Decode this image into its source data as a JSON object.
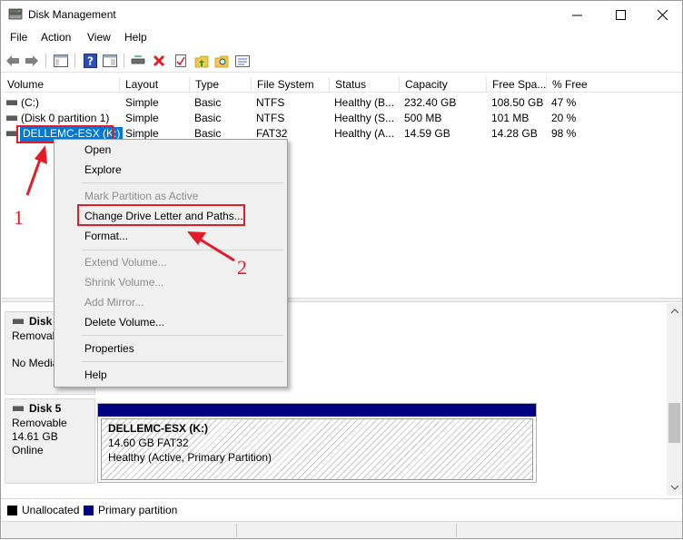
{
  "window": {
    "title": "Disk Management",
    "controls": {
      "minimize": "—",
      "maximize": "☐",
      "close": "✕"
    }
  },
  "menu": [
    "File",
    "Action",
    "View",
    "Help"
  ],
  "toolbar": {
    "icons": [
      "back-arrow-icon",
      "forward-arrow-icon",
      "console-tree-icon",
      "help-icon",
      "show-pane-icon",
      "connect-drive-icon",
      "delete-icon",
      "checklist-icon",
      "up-folder-icon",
      "search-folder-icon",
      "properties-icon"
    ]
  },
  "volume_table": {
    "columns": [
      "Volume",
      "Layout",
      "Type",
      "File System",
      "Status",
      "Capacity",
      "Free Spa...",
      "% Free"
    ],
    "rows": [
      [
        "(C:)",
        "Simple",
        "Basic",
        "NTFS",
        "Healthy (B...",
        "232.40 GB",
        "108.50 GB",
        "47 %"
      ],
      [
        "(Disk 0 partition 1)",
        "Simple",
        "Basic",
        "NTFS",
        "Healthy (S...",
        "500 MB",
        "101 MB",
        "20 %"
      ],
      [
        "DELLEMC-ESX (K:)",
        "Simple",
        "Basic",
        "FAT32",
        "Healthy (A...",
        "14.59 GB",
        "14.28 GB",
        "98 %"
      ]
    ]
  },
  "context_menu": {
    "items": [
      {
        "label": "Open",
        "enabled": true
      },
      {
        "label": "Explore",
        "enabled": true
      },
      {
        "label": "Mark Partition as Active",
        "enabled": false
      },
      {
        "label": "Change Drive Letter and Paths...",
        "enabled": true
      },
      {
        "label": "Format...",
        "enabled": true
      },
      {
        "label": "Extend Volume...",
        "enabled": false
      },
      {
        "label": "Shrink Volume...",
        "enabled": false
      },
      {
        "label": "Add Mirror...",
        "enabled": false
      },
      {
        "label": "Delete Volume...",
        "enabled": true
      },
      {
        "label": "Properties",
        "enabled": true
      },
      {
        "label": "Help",
        "enabled": true
      }
    ]
  },
  "disks": [
    {
      "name": "Disk 4",
      "name_visible": "Disk 4",
      "type": "Removable",
      "media": "No Media"
    },
    {
      "name": "Disk 5",
      "type": "Removable",
      "size": "14.61 GB",
      "status": "Online",
      "partition": {
        "label": "DELLEMC-ESX  (K:)",
        "size_fs": "14.60 GB FAT32",
        "health": "Healthy (Active, Primary Partition)"
      }
    }
  ],
  "legend": [
    {
      "label": "Unallocated",
      "color": "#000000"
    },
    {
      "label": "Primary partition",
      "color": "#000080"
    }
  ],
  "annotations": {
    "step1": "1",
    "step2": "2",
    "color": "#e21d27"
  },
  "colors": {
    "selection": "#0078d7",
    "primary_partition": "#000080"
  }
}
